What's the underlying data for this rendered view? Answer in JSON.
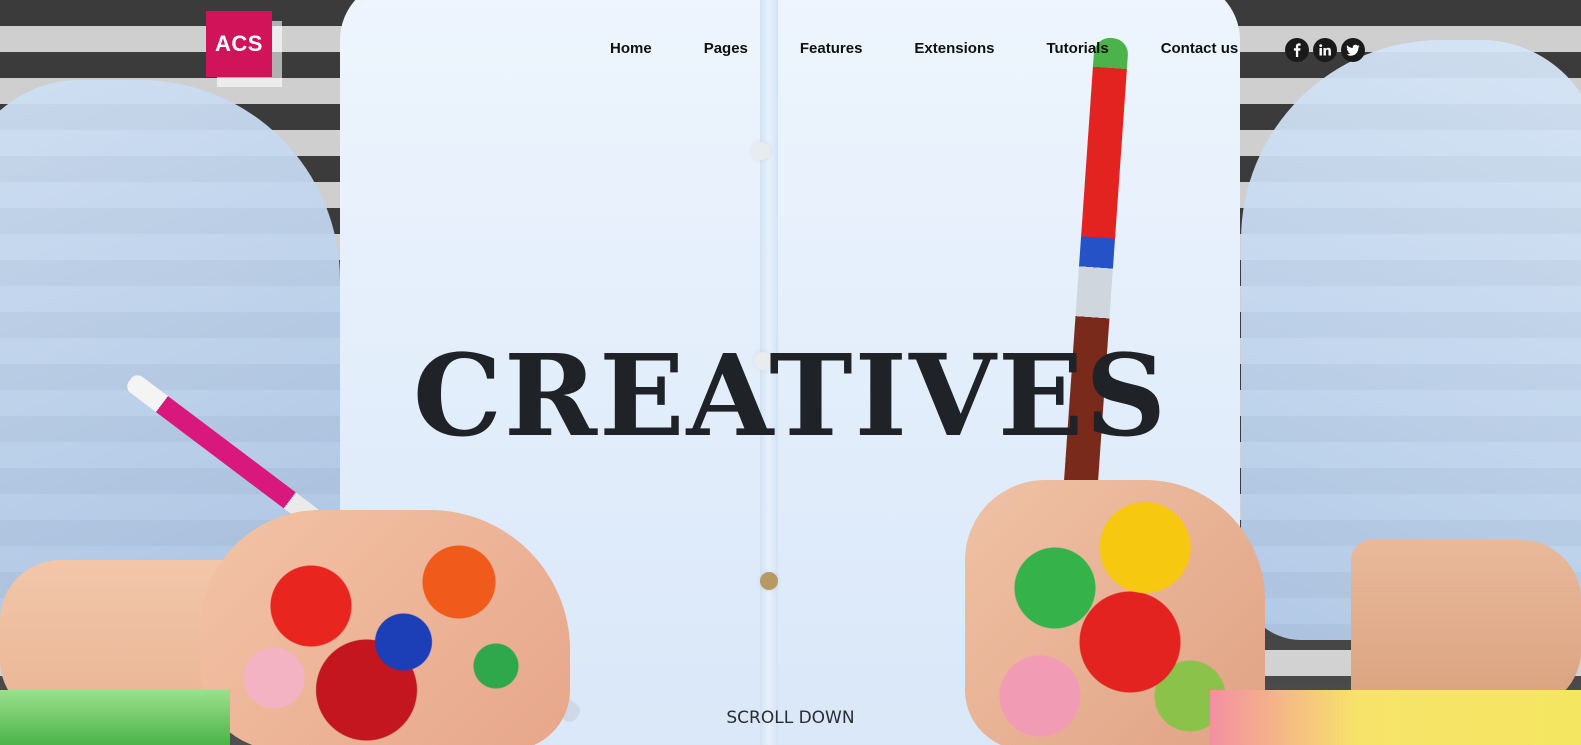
{
  "brand": {
    "logo_text": "ACS",
    "accent_color": "#d1145a"
  },
  "nav": {
    "items": [
      {
        "label": "Home"
      },
      {
        "label": "Pages"
      },
      {
        "label": "Features"
      },
      {
        "label": "Extensions"
      },
      {
        "label": "Tutorials"
      },
      {
        "label": "Contact us"
      }
    ]
  },
  "social": {
    "icons": [
      "facebook-icon",
      "linkedin-icon",
      "twitter-icon"
    ]
  },
  "hero": {
    "title": "CREATIVES",
    "scroll_label": "SCROLL DOWN"
  }
}
